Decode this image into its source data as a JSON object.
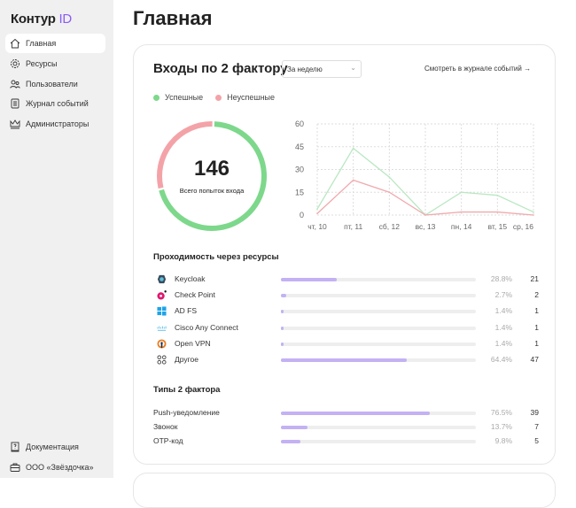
{
  "sidebar": {
    "logo": {
      "text": "Контур",
      "accent": "ID",
      "accent_color": "#8a5cf6"
    },
    "items": [
      {
        "label": "Главная",
        "icon": "home-icon",
        "active": true
      },
      {
        "label": "Ресурсы",
        "icon": "gear-icon"
      },
      {
        "label": "Пользователи",
        "icon": "users-icon"
      },
      {
        "label": "Журнал событий",
        "icon": "journal-icon"
      },
      {
        "label": "Администраторы",
        "icon": "crown-icon"
      }
    ],
    "bottom": [
      {
        "label": "Документация",
        "icon": "help-book-icon"
      },
      {
        "label": "ООО «Звёздочка»",
        "icon": "briefcase-icon"
      }
    ]
  },
  "page": {
    "title": "Главная"
  },
  "card": {
    "title": "Входы по 2 фактору",
    "period_select": "За неделю",
    "journal_link": "Смотреть в журнале событий →",
    "legend": [
      {
        "label": "Успешные",
        "color": "#7dd88b"
      },
      {
        "label": "Неуспешные",
        "color": "#f3a3a8"
      }
    ],
    "donut": {
      "total": "146",
      "label": "Всего попыток входа",
      "success": 103,
      "fail": 43
    },
    "resources_title": "Проходимость через ресурсы",
    "resources": [
      {
        "name": "Keycloak",
        "icon": "keycloak-icon",
        "percent": "28.8%",
        "value": 28.8,
        "count": "21"
      },
      {
        "name": "Check Point",
        "icon": "checkpoint-icon",
        "percent": "2.7%",
        "value": 2.7,
        "count": "2"
      },
      {
        "name": "AD FS",
        "icon": "windows-icon",
        "percent": "1.4%",
        "value": 1.4,
        "count": "1"
      },
      {
        "name": "Cisco Any Connect",
        "icon": "cisco-icon",
        "percent": "1.4%",
        "value": 1.4,
        "count": "1"
      },
      {
        "name": "Open VPN",
        "icon": "openvpn-icon",
        "percent": "1.4%",
        "value": 1.4,
        "count": "1"
      },
      {
        "name": "Другое",
        "icon": "grid-icon",
        "percent": "64.4%",
        "value": 64.4,
        "count": "47"
      }
    ],
    "types_title": "Типы 2 фактора",
    "types": [
      {
        "name": "Push-уведомление",
        "percent": "76.5%",
        "value": 76.5,
        "count": "39"
      },
      {
        "name": "Звонок",
        "percent": "13.7%",
        "value": 13.7,
        "count": "7"
      },
      {
        "name": "OTP-код",
        "percent": "9.8%",
        "value": 9.8,
        "count": "5"
      }
    ]
  },
  "chart_data": {
    "type": "line",
    "categories": [
      "чт, 10",
      "пт, 11",
      "сб, 12",
      "вс, 13",
      "пн, 14",
      "вт, 15",
      "ср, 16"
    ],
    "yticks": [
      "0",
      "15",
      "30",
      "45",
      "60"
    ],
    "ylim": [
      0,
      60
    ],
    "grid": true,
    "series": [
      {
        "name": "Успешные",
        "color": "#b9e8c1",
        "values": [
          4,
          44,
          25,
          0,
          15,
          13,
          2
        ]
      },
      {
        "name": "Неуспешные",
        "color": "#f0a9ad",
        "values": [
          1,
          23,
          15,
          0,
          2,
          2,
          0
        ]
      }
    ]
  }
}
